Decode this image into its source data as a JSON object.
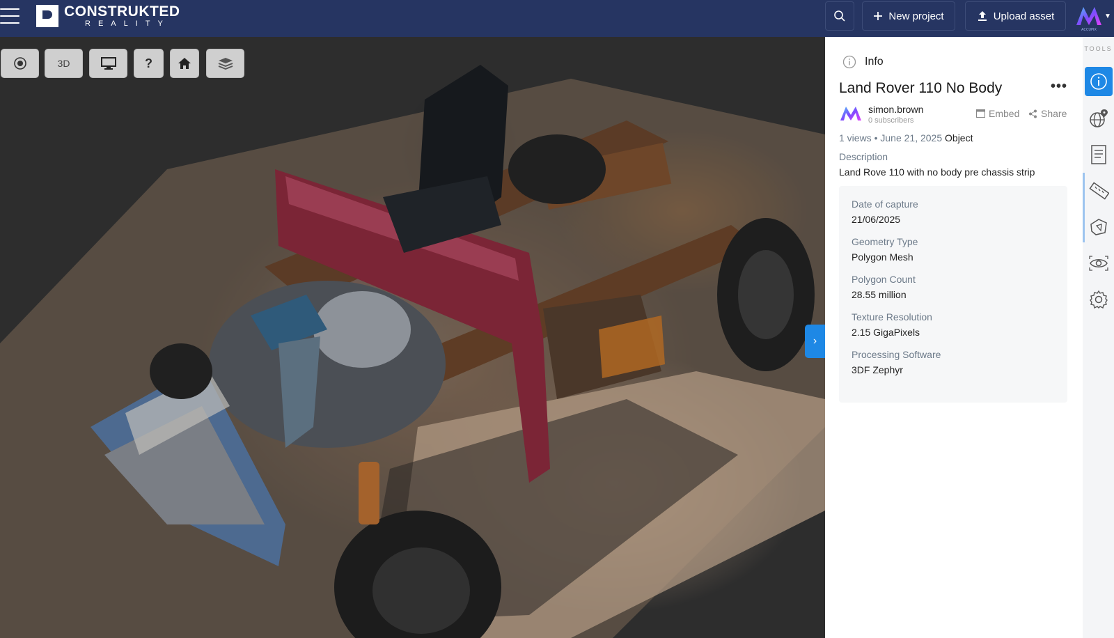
{
  "app": {
    "logo_line1": "CONSTRUKTED",
    "logo_line2": "REALITY"
  },
  "header": {
    "new_project_label": "New project",
    "upload_asset_label": "Upload asset",
    "brand_avatar_text": "ACCUPIX"
  },
  "viewer": {
    "toolbar": {
      "three_d_label": "3D",
      "help_label": "?"
    },
    "icons": [
      "orbit-sphere-icon",
      "monitor-icon",
      "help-icon",
      "home-icon",
      "layers-icon",
      "chevron-right-icon"
    ]
  },
  "info": {
    "header_label": "Info",
    "title": "Land Rover 110 No Body",
    "author_name": "simon.brown",
    "author_subscribers": "0 subscribers",
    "embed_label": "Embed",
    "share_label": "Share",
    "views": "1 views",
    "bullet": "•",
    "date": "June 21, 2025",
    "asset_type": "Object",
    "description_label": "Description",
    "description": "Land Rove 110 with no body pre chassis strip",
    "details": [
      {
        "label": "Date of capture",
        "value": "21/06/2025"
      },
      {
        "label": "Geometry Type",
        "value": "Polygon Mesh"
      },
      {
        "label": "Polygon Count",
        "value": "28.55 million"
      },
      {
        "label": "Texture Resolution",
        "value": "2.15 GigaPixels"
      },
      {
        "label": "Processing Software",
        "value": "3DF Zephyr"
      }
    ]
  },
  "tools": {
    "label": "TOOLS",
    "items": [
      "info-icon",
      "globe-pin-icon",
      "document-icon",
      "ruler-icon",
      "annotation-shape-icon",
      "eye-icon",
      "gear-icon"
    ]
  },
  "colors": {
    "topbar": "#263562",
    "accent": "#1e88e5"
  }
}
